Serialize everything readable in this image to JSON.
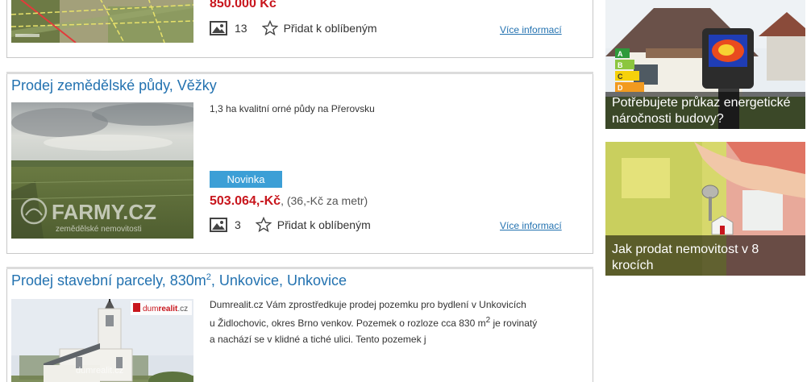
{
  "listings": [
    {
      "price": "850.000 Kč",
      "photo_count": "13",
      "favorite_label": "Přidat k oblíbeným",
      "more_label": "Více informací"
    },
    {
      "title": "Prodej zemědělské půdy, Věžky",
      "description": "1,3 ha kvalitní orné půdy na Přerovsku",
      "badge": "Novinka",
      "price": "503.064,-Kč",
      "price_note": ", (36,-Kč za metr)",
      "photo_count": "3",
      "favorite_label": "Přidat k oblíbeným",
      "more_label": "Více informací",
      "watermark": "FARMY.CZ",
      "watermark_sub": "zemědělské nemovitosti"
    },
    {
      "title_prefix": "Prodej stavební parcely, 830m",
      "title_sup": "2",
      "title_suffix": ", Unkovice, Unkovice",
      "description_line1": "Dumrealit.cz Vám zprostředkuje prodej pozemku pro bydlení v Unkovicích",
      "description_line2a": "u Židlochovic, okres Brno venkov. Pozemek o rozloze cca 830 m",
      "description_line2_sup": "2",
      "description_line2b": " je rovinatý",
      "description_line3": "a nachází se v klidné a tiché ulici. Tento pozemek j",
      "logo_a": "dum",
      "logo_b": "realit",
      "logo_c": ".cz",
      "watermark": "dumrealit.cz"
    }
  ],
  "promos": [
    {
      "caption": "Potřebujete průkaz energetické náročnosti budovy?",
      "energy_labels": [
        "A",
        "B",
        "C",
        "D"
      ]
    },
    {
      "caption": "Jak prodat nemovitost v 8 krocích"
    }
  ]
}
